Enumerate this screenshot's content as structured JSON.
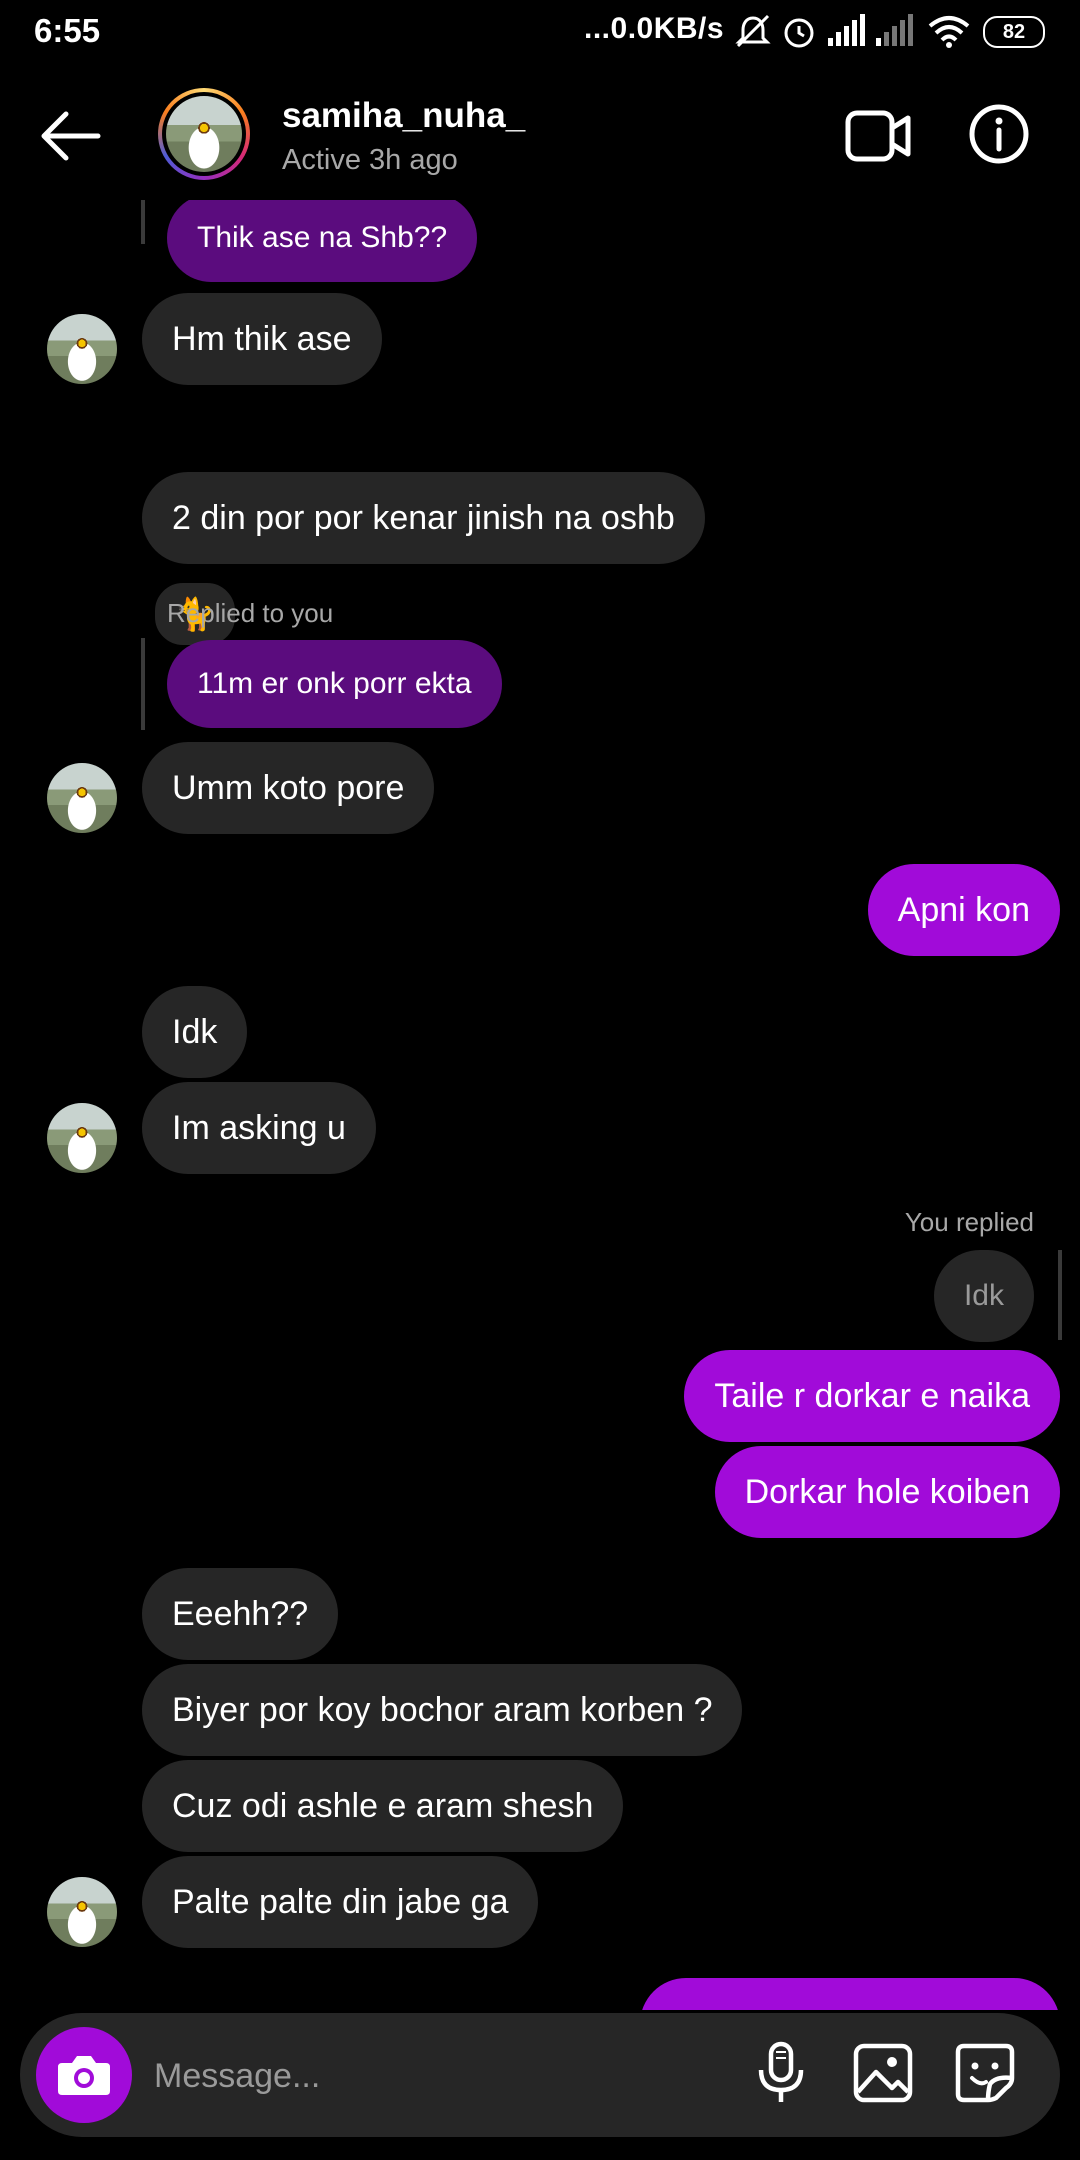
{
  "status_bar": {
    "time": "6:55",
    "network": "...0.0KB/s",
    "battery": "82"
  },
  "header": {
    "username": "samiha_nuha_",
    "status": "Active 3h ago"
  },
  "messages": [
    {
      "dir": "in",
      "text": "Thik ase na Shb??",
      "quoted": true
    },
    {
      "dir": "in",
      "text": "Hm thik ase",
      "reaction": "🐈"
    },
    {
      "dir": "in",
      "text": "2 din por por kenar jinish na oshb"
    },
    {
      "dir": "in",
      "meta": "Replied to you",
      "text": "11m er onk porr ekta",
      "quoted": true
    },
    {
      "dir": "in",
      "text": "Umm koto pore"
    },
    {
      "dir": "out",
      "text": "Apni kon"
    },
    {
      "dir": "in",
      "text": "Idk"
    },
    {
      "dir": "in",
      "text": "Im asking u"
    },
    {
      "dir": "out",
      "meta": "You replied",
      "text": "Idk",
      "quoted": true
    },
    {
      "dir": "out",
      "text": "Taile r dorkar e naika"
    },
    {
      "dir": "out",
      "text": "Dorkar hole koiben"
    },
    {
      "dir": "in",
      "text": "Eeehh??"
    },
    {
      "dir": "in",
      "text": "Biyer por koy bochor aram korben ?"
    },
    {
      "dir": "in",
      "text": "Cuz odi ashle e aram shesh"
    },
    {
      "dir": "in",
      "text": "Palte palte din jabe ga"
    }
  ],
  "composer": {
    "placeholder": "Message..."
  },
  "colors": {
    "accent": "#a10bd9",
    "quote": "#5b0c7e",
    "bubble_in": "#262626",
    "background": "#000000"
  },
  "icons": [
    "back-arrow-icon",
    "video-call-icon",
    "info-icon",
    "camera-icon",
    "microphone-icon",
    "gallery-icon",
    "sticker-icon"
  ]
}
